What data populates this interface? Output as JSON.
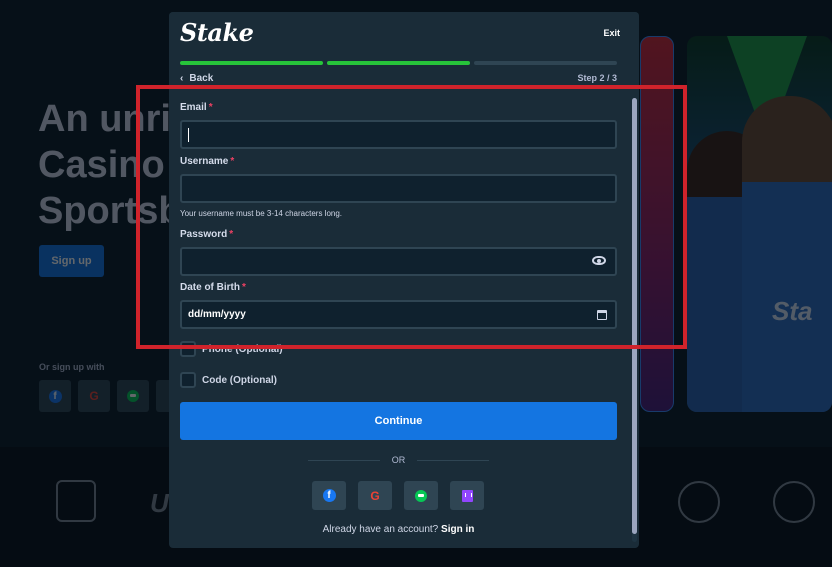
{
  "background": {
    "hero_lines": [
      "An unri",
      "Casino",
      "Sportsb"
    ],
    "signup_label": "Sign up",
    "or_signup_label": "Or sign up with",
    "social_icons": [
      "facebook-icon",
      "google-icon",
      "line-icon"
    ]
  },
  "modal": {
    "brand": "Stake",
    "exit_label": "Exit",
    "back_label": "Back",
    "step_label": "Step 2 / 3",
    "progress": {
      "completed_steps": 2,
      "total_steps": 3
    },
    "fields": {
      "email": {
        "label": "Email",
        "required": "*",
        "value": ""
      },
      "username": {
        "label": "Username",
        "required": "*",
        "value": "",
        "hint": "Your username must be 3-14 characters long."
      },
      "password": {
        "label": "Password",
        "required": "*",
        "value": "",
        "icon": "eye-icon"
      },
      "dob": {
        "label": "Date of Birth",
        "required": "*",
        "placeholder": "dd/mm/yyyy",
        "icon": "calendar-icon"
      }
    },
    "phone_label": "Phone (Optional)",
    "code_label": "Code (Optional)",
    "continue_label": "Continue",
    "or_label": "OR",
    "social_buttons": [
      "facebook-icon",
      "google-icon",
      "line-icon",
      "twitch-icon"
    ],
    "already_text": "Already have an account?",
    "signin_label": "Sign in"
  },
  "colors": {
    "accent": "#1475e1",
    "progress_done": "#27c43a",
    "required": "#ed4163",
    "highlight": "#d0232b"
  }
}
